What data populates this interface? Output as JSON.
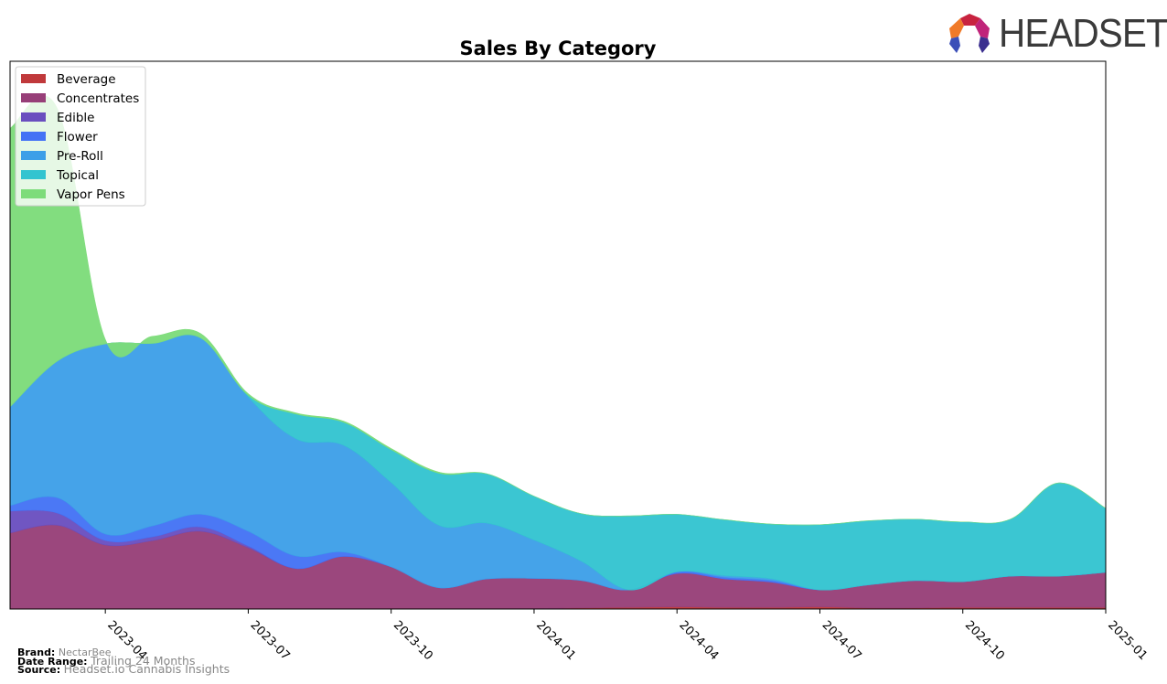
{
  "brand_logo": {
    "text": "HEADSET"
  },
  "footer": {
    "brand_label": "Brand:",
    "brand_value": "NectarBee",
    "date_range_label": "Date Range:",
    "date_range_value": "Trailing 24 Months",
    "source_label": "Source:",
    "source_value": "Headset.io Cannabis Insights"
  },
  "chart_data": {
    "type": "area",
    "stacked": true,
    "title": "Sales By Category",
    "xlabel": "",
    "ylabel": "",
    "y_tick_labels_visible": false,
    "ylim": [
      0,
      100
    ],
    "grid": false,
    "legend_position": "top-left",
    "x": [
      "2023-02",
      "2023-03",
      "2023-04",
      "2023-05",
      "2023-06",
      "2023-07",
      "2023-08",
      "2023-09",
      "2023-10",
      "2023-11",
      "2023-12",
      "2024-01",
      "2024-02",
      "2024-03",
      "2024-04",
      "2024-05",
      "2024-06",
      "2024-07",
      "2024-08",
      "2024-09",
      "2024-10",
      "2024-11",
      "2024-12",
      "2025-01"
    ],
    "x_ticks": [
      "2023-04",
      "2023-07",
      "2023-10",
      "2024-01",
      "2024-04",
      "2024-07",
      "2024-10",
      "2025-01"
    ],
    "series": [
      {
        "name": "Beverage",
        "color": "#c0393b",
        "values": [
          0.1,
          0.1,
          0.1,
          0.1,
          0.1,
          0.1,
          0.1,
          0.1,
          0.1,
          0.1,
          0.1,
          0.1,
          0.2,
          0.3,
          0.4,
          0.3,
          0.3,
          0.4,
          0.2,
          0.2,
          0.3,
          0.3,
          0.3,
          0.3
        ]
      },
      {
        "name": "Concentrates",
        "color": "#973f78",
        "values": [
          13.8,
          15.2,
          11.6,
          12.4,
          14.1,
          11.1,
          7.3,
          9.5,
          7.6,
          3.8,
          5.4,
          5.5,
          5.0,
          3.2,
          6.1,
          5.2,
          4.6,
          3.1,
          4.2,
          5.0,
          4.7,
          5.7,
          5.7,
          6.4
        ]
      },
      {
        "name": "Edible",
        "color": "#6a4fbf",
        "values": [
          4.0,
          2.2,
          0.8,
          0.7,
          0.8,
          0.3,
          0,
          0,
          0,
          0,
          0,
          0,
          0,
          0,
          0,
          0,
          0,
          0,
          0,
          0,
          0,
          0,
          0,
          0
        ]
      },
      {
        "name": "Flower",
        "color": "#4472f5",
        "values": [
          1.0,
          2.8,
          1.2,
          2.0,
          2.3,
          2.7,
          2.3,
          0.8,
          0,
          0,
          0,
          0,
          0,
          0,
          0.3,
          0.3,
          0.3,
          0,
          0,
          0,
          0,
          0,
          0,
          0
        ]
      },
      {
        "name": "Pre-Roll",
        "color": "#3d9fe8",
        "values": [
          18.0,
          25.0,
          34.7,
          33.3,
          32.2,
          24.5,
          21.4,
          19.5,
          15.4,
          11.4,
          10.2,
          7.0,
          3.5,
          0,
          0,
          0.3,
          0.3,
          0,
          0,
          0,
          0,
          0,
          0,
          0
        ]
      },
      {
        "name": "Topical",
        "color": "#33c4d0",
        "values": [
          0,
          0,
          0,
          0,
          0,
          0.3,
          4.5,
          4.2,
          6.0,
          9.5,
          9.0,
          8.0,
          8.7,
          13.5,
          10.5,
          10.2,
          10.0,
          11.9,
          11.7,
          11.2,
          10.9,
          10.4,
          17.0,
          11.7
        ]
      },
      {
        "name": "Vapor Pens",
        "color": "#7ddc7a",
        "values": [
          50.9,
          45.9,
          0.8,
          1.3,
          0.8,
          0.3,
          0.2,
          0.2,
          0.2,
          0.2,
          0,
          0,
          0,
          0,
          0,
          0,
          0,
          0,
          0,
          0,
          0,
          0,
          0,
          0
        ]
      }
    ]
  }
}
